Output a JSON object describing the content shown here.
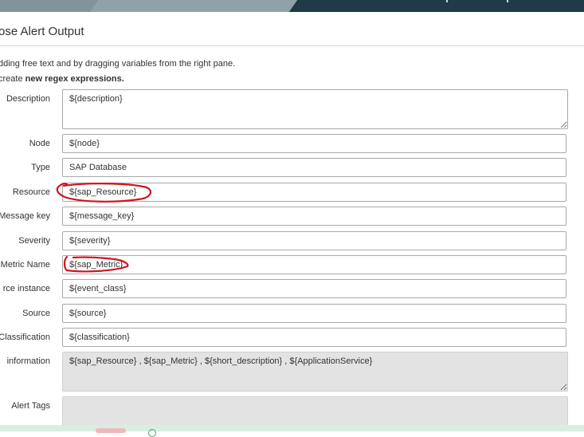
{
  "title": "ose Alert Output",
  "intro": {
    "line1": "dding free text and by dragging variables from the right pane.",
    "line2_prefix": "create ",
    "line2_bold": "new regex expressions."
  },
  "fields": {
    "description": {
      "label": "Description",
      "value": "${description}"
    },
    "node": {
      "label": "Node",
      "value": "${node}"
    },
    "type": {
      "label": "Type",
      "value": "SAP Database"
    },
    "resource": {
      "label": "Resource",
      "value": "${sap_Resource}"
    },
    "message_key": {
      "label": "Message key",
      "value": "${message_key}"
    },
    "severity": {
      "label": "Severity",
      "value": "${severity}"
    },
    "metric_name": {
      "label": "Metric Name",
      "value": "${sap_Metric}"
    },
    "source_instance": {
      "label": "rce instance",
      "value": "${event_class}"
    },
    "source": {
      "label": "Source",
      "value": "${source}"
    },
    "classification": {
      "label": "Classification",
      "value": "${classification}"
    },
    "information": {
      "label": "information",
      "value": "${sap_Resource} , ${sap_Metric} , ${short_description} , ${ApplicationService}"
    },
    "alert_tags": {
      "label": "Alert Tags",
      "value": ""
    }
  },
  "colors": {
    "annotation_red": "#d0141e",
    "topbar_grey": "#7f949d",
    "topbar_dark": "#1f3b48",
    "readonly_bg": "#e3e3e3"
  }
}
